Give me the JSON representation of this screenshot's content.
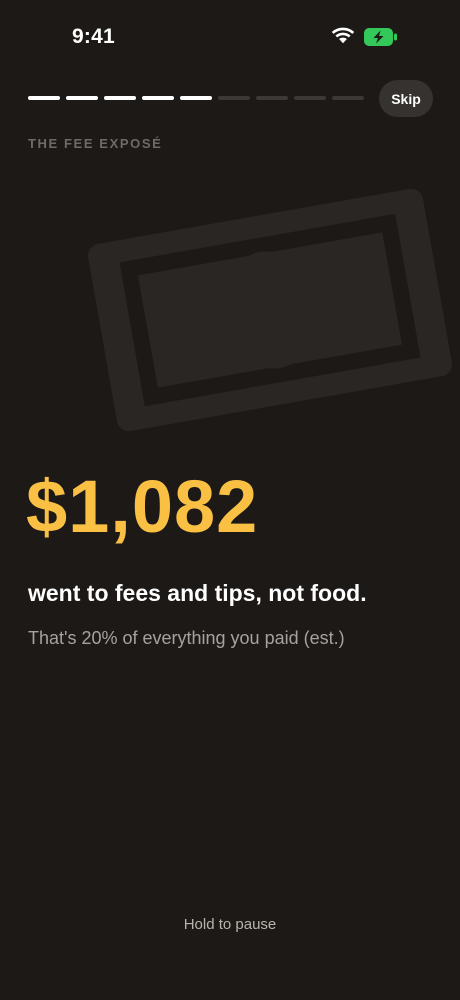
{
  "status_bar": {
    "time": "9:41"
  },
  "story": {
    "progress": {
      "total_segments": 9,
      "completed_segments": 5
    },
    "skip_label": "Skip",
    "eyebrow": "THE FEE EXPOSÉ",
    "illustration_icon": "banknote-icon",
    "amount": "$1,082",
    "headline": "went to fees and tips, not food.",
    "subtext": "That's 20% of everything you paid (est.)",
    "hold_hint": "Hold to pause"
  },
  "colors": {
    "background": "#1c1917",
    "accent": "#fac044",
    "battery": "#34c759"
  }
}
